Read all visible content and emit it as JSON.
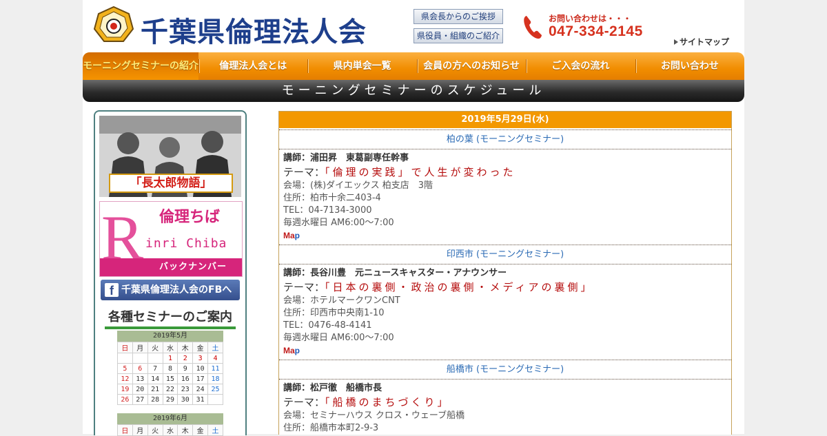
{
  "header": {
    "site_title": "千葉県倫理法人会",
    "greeting_link": "県会長からのご挨拶",
    "officers_link": "県役員・組織のご紹介",
    "contact_label": "お問い合わせは・・・",
    "phone": "047-334-2145",
    "sitemap": "サイトマップ"
  },
  "nav": {
    "items": [
      "モーニングセミナーの紹介",
      "倫理法人会とは",
      "県内単会一覧",
      "会員の方へのお知らせ",
      "ご入会の流れ",
      "お問い合わせ"
    ]
  },
  "page_title": "モーニングセミナーのスケジュール",
  "sidebar": {
    "banner1_caption": "「長太郎物語」",
    "banner2_letter": "R",
    "banner2_title": "倫理ちば",
    "banner2_sub": "inri Chiba",
    "banner2_bar": "バックナンバー",
    "fb_icon": "f",
    "fb_label": "千葉県倫理法人会のFBへ",
    "seminar_heading": "各種セミナーのご案内",
    "calendar_may": {
      "title": "2019年5月",
      "weekdays": [
        "日",
        "月",
        "火",
        "水",
        "木",
        "金",
        "土"
      ],
      "weeks": [
        [
          "",
          "",
          "",
          "1",
          "2",
          "3",
          "4"
        ],
        [
          "5",
          "6",
          "7",
          "8",
          "9",
          "10",
          "11"
        ],
        [
          "12",
          "13",
          "14",
          "15",
          "16",
          "17",
          "18"
        ],
        [
          "19",
          "20",
          "21",
          "22",
          "23",
          "24",
          "25"
        ],
        [
          "26",
          "27",
          "28",
          "29",
          "30",
          "31",
          ""
        ]
      ]
    },
    "calendar_june": {
      "title": "2019年6月",
      "weekdays": [
        "日",
        "月",
        "火",
        "水",
        "木",
        "金",
        "土"
      ]
    }
  },
  "schedule": {
    "date": "2019年5月29日(水)",
    "entries": [
      {
        "venue": "柏の葉 (モーニングセミナー)",
        "speaker": "講師：浦田昇　東葛副専任幹事",
        "theme_label": "テーマ：",
        "theme": "「倫理の実践」で人生が変わった",
        "place": "会場：(株)ダイエックス 柏支店　3階",
        "address": "住所：柏市十余二403-4",
        "tel": "TEL：04-7134-3000",
        "time": "毎週水曜日 AM6:00～7:00",
        "map_a": "Ma",
        "map_b": "p"
      },
      {
        "venue": "印西市 (モーニングセミナー)",
        "speaker": "講師：長谷川豊　元ニュースキャスター・アナウンサー",
        "theme_label": "テーマ：",
        "theme": "「日本の裏側・政治の裏側・メディアの裏側」",
        "place": "会場：ホテルマークワンCNT",
        "address": "住所：印西市中央南1-10",
        "tel": "TEL：0476-48-4141",
        "time": "毎週水曜日 AM6:00～7:00",
        "map_a": "Ma",
        "map_b": "p"
      },
      {
        "venue": "船橋市 (モーニングセミナー)",
        "speaker": "講師：松戸徹　船橋市長",
        "theme_label": "テーマ：",
        "theme": "「船橋のまちづくり」",
        "place": "会場：セミナーハウス クロス・ウェーブ船橋",
        "address": "住所：船橋市本町2-9-3"
      }
    ]
  }
}
